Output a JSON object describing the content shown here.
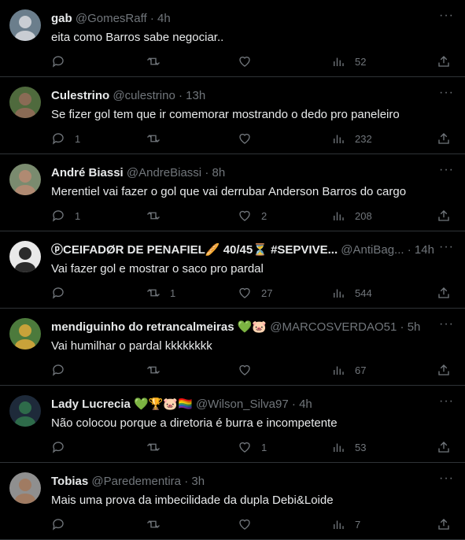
{
  "tweets": [
    {
      "name": "gab",
      "handle": "@GomesRaff",
      "time": "4h",
      "text": "eita como Barros sabe negociar..",
      "replies": "",
      "retweets": "",
      "likes": "",
      "views": "52",
      "avatar_color": "#c9cdd3",
      "avatar_bg": "#6b7e8c"
    },
    {
      "name": "Culestrino",
      "handle": "@culestrino",
      "time": "13h",
      "text": "Se fizer gol tem que ir comemorar mostrando o dedo pro paneleiro",
      "replies": "1",
      "retweets": "",
      "likes": "",
      "views": "232",
      "avatar_color": "#8a6b55",
      "avatar_bg": "#4f6a3d"
    },
    {
      "name": "André Biassi",
      "handle": "@AndreBiassi",
      "time": "8h",
      "text": "Merentiel vai fazer o gol que vai derrubar Anderson Barros do cargo",
      "replies": "1",
      "retweets": "",
      "likes": "2",
      "views": "208",
      "avatar_color": "#b08a72",
      "avatar_bg": "#7a8b6f"
    },
    {
      "name": "ⓟCEIFADØR DE PENAFIEL🥖 40/45⏳ #SEPVIVE...",
      "handle": "@AntiBag...",
      "time": "14h",
      "text": "Vai fazer gol e mostrar o saco pro pardal",
      "replies": "",
      "retweets": "1",
      "likes": "27",
      "views": "544",
      "avatar_color": "#2b2b2b",
      "avatar_bg": "#e9e9e9"
    },
    {
      "name": "mendiguinho do retrancalmeiras 💚🐷",
      "handle": "@MARCOSVERDAO51",
      "time": "5h",
      "text": "Vai humilhar o pardal kkkkkkkk",
      "replies": "",
      "retweets": "",
      "likes": "",
      "views": "67",
      "avatar_color": "#c8a23a",
      "avatar_bg": "#4c7a3c"
    },
    {
      "name": "Lady Lucrecia 💚🏆🐷🏳️‍🌈",
      "handle": "@Wilson_Silva97",
      "time": "4h",
      "text": "Não colocou porque a diretoria é burra e incompetente",
      "replies": "",
      "retweets": "",
      "likes": "1",
      "views": "53",
      "avatar_color": "#2e6b4a",
      "avatar_bg": "#1e2a3a"
    },
    {
      "name": "Tobias",
      "handle": "@Paredementira",
      "time": "3h",
      "text": "Mais uma prova da imbecilidade da dupla Debi&Loide",
      "replies": "",
      "retweets": "",
      "likes": "",
      "views": "7",
      "avatar_color": "#a07b62",
      "avatar_bg": "#8f8f8f"
    }
  ],
  "more_label": "···"
}
